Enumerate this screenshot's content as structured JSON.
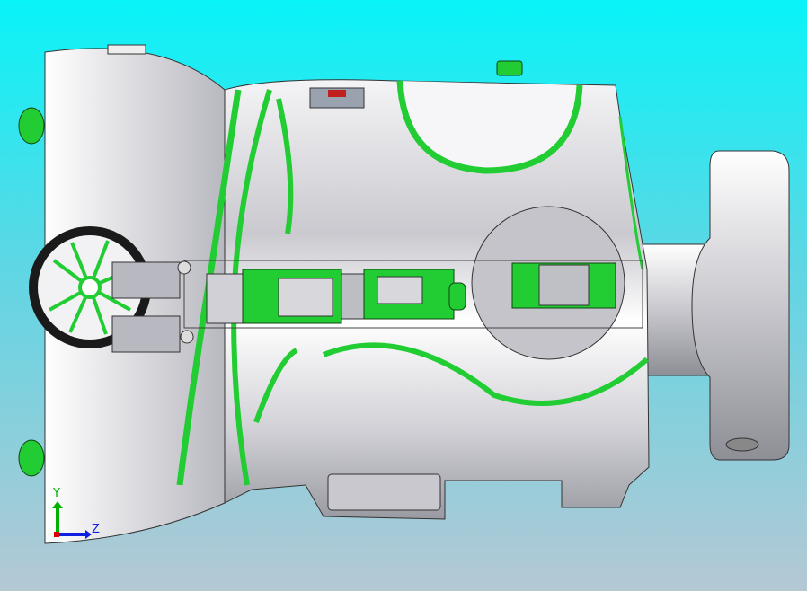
{
  "viewport": {
    "triad": {
      "y_label": "Y",
      "z_label": "Z"
    },
    "colors": {
      "background_top": "#08f4f8",
      "background_bottom": "#b4c8d4",
      "body": "#d8d8dc",
      "accent_green": "#22cc33",
      "triad_y": "#00b000",
      "triad_z": "#1020e0",
      "triad_x": "#e00000"
    }
  }
}
